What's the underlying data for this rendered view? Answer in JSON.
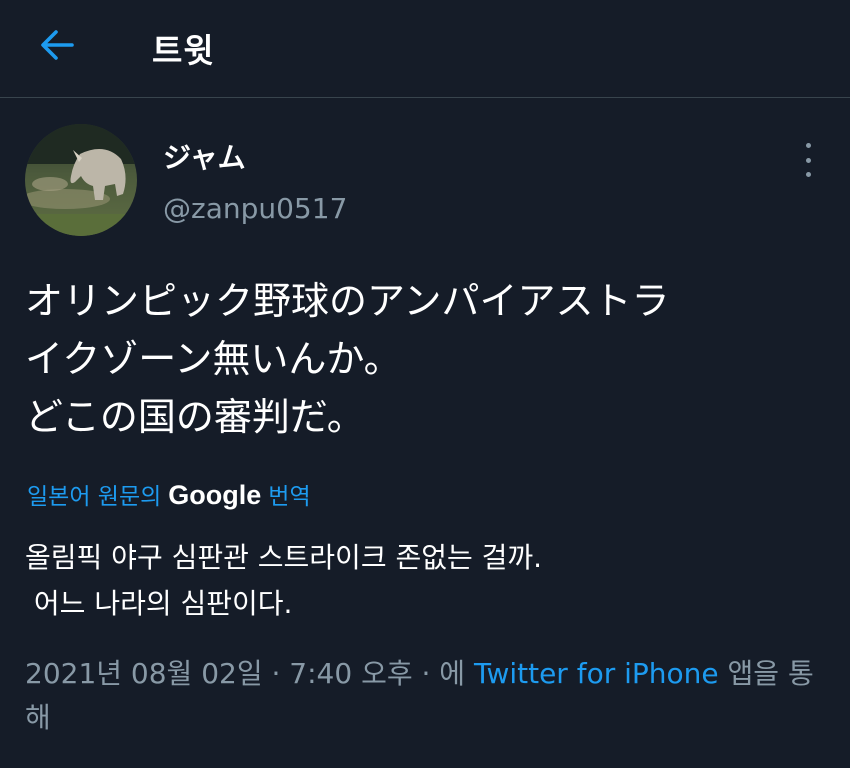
{
  "header": {
    "back_icon": "arrow-left-icon",
    "title": "트윗"
  },
  "tweet": {
    "display_name": "ジャム",
    "handle": "@zanpu0517",
    "more_icon": "more-vertical-icon",
    "text_lines": [
      "オリンピック野球のアンパイアストラ",
      "イクゾーン無いんか。",
      "どこの国の審判だ。"
    ],
    "translate": {
      "prefix": "일본어 원문의",
      "brand": "Google",
      "suffix": "번역"
    },
    "translated_lines": [
      "올림픽 야구 심판관 스트라이크 존없는 걸까.",
      " 어느 나라의 심판이다."
    ],
    "meta": {
      "datetime": "2021년 08월 02일 · 7:40 오후 · 에 ",
      "source": "Twitter for iPhone",
      "suffix": " 앱을 통해"
    }
  },
  "colors": {
    "background": "#151c28",
    "accent": "#1d9bf0",
    "secondary_text": "#8899a6",
    "divider": "#38444d"
  }
}
